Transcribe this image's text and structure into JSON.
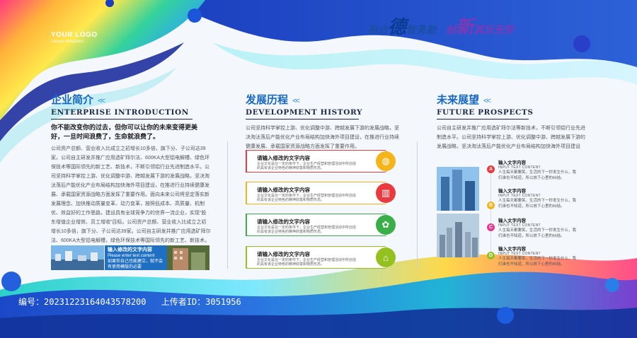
{
  "logo": {
    "title": "YOUR LOGO",
    "subtitle": "Design templates"
  },
  "slogan": {
    "p1": "融合",
    "p2": "德",
    "p3": "智勇勤",
    "p4": "创",
    "p5": "新",
    "p6": "其乐无穷"
  },
  "enterprise": {
    "title_cn": "企业简介",
    "title_en": "ENTERPRISE INTRODUCTION",
    "quote": "你不能改变你的过去，但你可以让你的未来变得更美好，一旦时间浪费了，生命就浪费了。",
    "body": "公司资产总额、营业收入比成立之初增长10多倍，旗下分、子公司达39家。公司自主研发并推广应用选矿拜尔法、600KA大型铝电解槽、绿色环保技术等国际领先的新工艺、新技术，不断引领铝行业先进制造水平。公司坚持科学掌控上游、优化调整中游、跨越发展下游的发展战略，坚决淘汰落后产能优化产业布局结构加快海外项目建设，在推进行业持续健康发展、承载国家资源战略方面发挥了重要作用。面向未来公司将坚定落实新发展理念、加快推动质量变革、动力变革，按照低成本、高质量、机制优、效益好的工作思路，建设具有全球竞争力的世界一流企业，实现“股东增值企业增效、员工增收”目标。公司资产总额、营业收入比成立之初增长10多倍，旗下分、子公司达39家。公司自主研发并推广应用选矿拜尔法、600KA大型铝电解槽，绿色环保技术等国际领先的新工艺、新技术。",
    "caption_title": "输入修改的文字内容",
    "caption_en": "Please enter text content",
    "caption_body": "如果你自己也能建立，就不会有使用模版的必要"
  },
  "history": {
    "title_cn": "发展历程",
    "title_en": "DEVELOPMENT HISTORY",
    "body": "公司坚持科学掌控上游、优化调整中游、跨越发展下游的发展战略，坚决淘汰落后产能优化产业布局结构加快海外项目建设，在推进行业持续健康发展、承载国家资源战略方面发挥了重要作用。",
    "items": [
      {
        "title": "请输入修改的文字内容",
        "desc": "企业文化是在一定的条件下，企业生产经营和管理活动中所创造的具有该企业特色的精神财富和物质形态。",
        "color": "#e83a3f",
        "icon": "globe-icon",
        "glyph": "◍"
      },
      {
        "title": "请输入修改的文字内容",
        "desc": "企业文化是在一定的条件下，企业生产经营和管理活动中所创造的具有该企业特色的精神财富和物质形态。",
        "color": "#f5b51a",
        "icon": "chart-icon",
        "glyph": "▥"
      },
      {
        "title": "请输入修改的文字内容",
        "desc": "企业文化是在一定的条件下，企业生产经营和管理活动中所创造的具有该企业特色的精神财富和物质形态。",
        "color": "#3aae49",
        "icon": "team-icon",
        "glyph": "✿"
      },
      {
        "title": "请输入修改的文字内容",
        "desc": "企业文化是在一定的条件下，企业生产经营和管理活动中所创造的具有该企业特色的精神财富和物质形态。",
        "color": "#94c11f",
        "icon": "graduation-cap-icon",
        "glyph": "🎓"
      }
    ]
  },
  "future": {
    "title_cn": "未来展望",
    "title_en": "FUTURE PROSPECTS",
    "body": "公司自主研发并推广应用选矿拜尔法等新技术，不断引领铝行业先进制造水平。公司坚持科学掌控上游、优化调整中游、跨越发展下游的发展战略，坚决淘汰落后产能优化产业布局结构加快海外项目建设",
    "items": [
      {
        "badge": "A",
        "color": "#e83a3f",
        "title": "输入文字内容",
        "en": "INPUT TEXT CONTENT",
        "desc": "人生每天都要笑，生活的下一秒发生什么，我们谁也不知道，所以放下心里的纠结。"
      },
      {
        "badge": "B",
        "color": "#f5b51a",
        "title": "输入文字内容",
        "en": "INPUT TEXT CONTENT",
        "desc": "人生每天都要笑，生活的下一秒发生什么，我们谁也不知道，所以放下心里的纠结。"
      },
      {
        "badge": "C",
        "color": "#e8388e",
        "title": "输入文字内容",
        "en": "INPUT TEXT CONTENT",
        "desc": "人生每天都要笑，生活的下一秒发生什么，我们谁也不知道，所以放下心里的纠结。"
      },
      {
        "badge": "D",
        "color": "#94c11f",
        "title": "输入文字内容",
        "en": "INPUT TEXT CONTENT",
        "desc": "人生每天都要笑，生活的下一秒发生什么，我们谁也不知道，所以放下心里的纠结。"
      }
    ]
  },
  "footer": {
    "id_label": "编号：20231223164043578200",
    "uploader_label": "上传者ID：3051956"
  }
}
